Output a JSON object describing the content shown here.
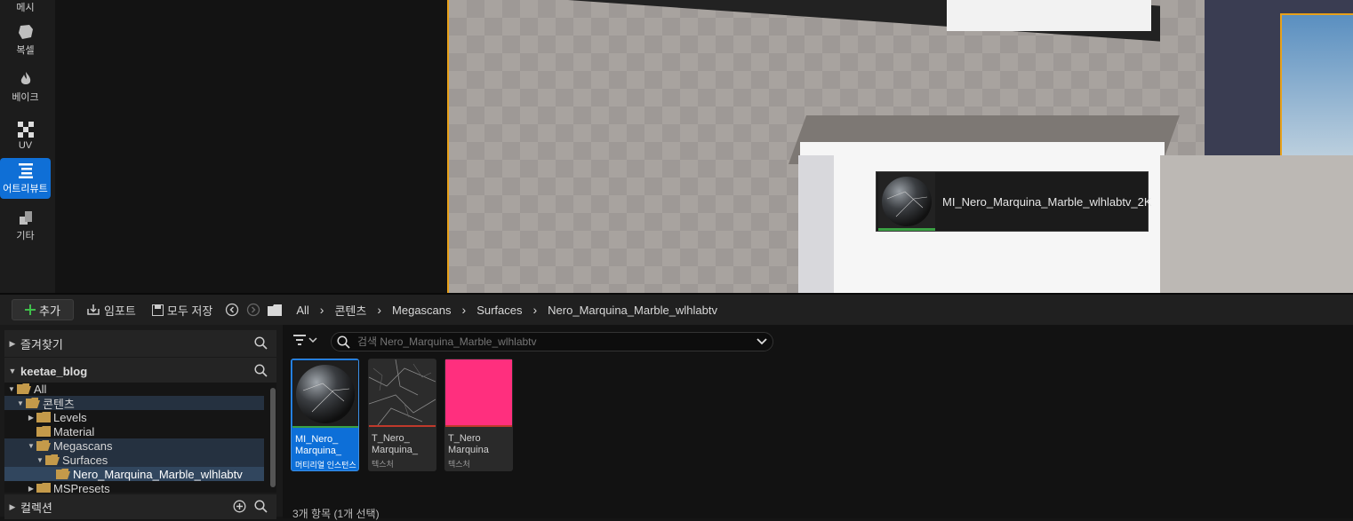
{
  "modebar": {
    "items": [
      {
        "label": "메시",
        "icon": "mesh-icon"
      },
      {
        "label": "복셀",
        "icon": "voxel-icon"
      },
      {
        "label": "베이크",
        "icon": "flame-icon"
      },
      {
        "label": "UV",
        "icon": "checker-icon"
      },
      {
        "label": "어트리뷰트",
        "icon": "list-icon",
        "active": true
      },
      {
        "label": "기타",
        "icon": "misc-icon"
      }
    ]
  },
  "viewport": {
    "drag_tooltip": "MI_Nero_Marquina_Marble_wlhlabtv_2K",
    "accent_color": "#e8a11a"
  },
  "toolbar": {
    "add_label": "추가",
    "import_label": "임포트",
    "save_all_label": "모두 저장",
    "breadcrumbs": [
      "All",
      "콘텐츠",
      "Megascans",
      "Surfaces",
      "Nero_Marquina_Marble_wlhlabtv"
    ]
  },
  "sources": {
    "favorites_label": "즐겨찾기",
    "project_label": "keetae_blog",
    "collections_label": "컬렉션",
    "tree": [
      {
        "label": "All"
      },
      {
        "label": "콘텐츠"
      },
      {
        "label": "Levels"
      },
      {
        "label": "Material"
      },
      {
        "label": "Megascans"
      },
      {
        "label": "Surfaces"
      },
      {
        "label": "Nero_Marquina_Marble_wlhlabtv"
      },
      {
        "label": "MSPresets"
      }
    ]
  },
  "assets": {
    "search_placeholder": "검색 Nero_Marquina_Marble_wlhlabtv",
    "items": [
      {
        "name_line1": "MI_Nero_",
        "name_line2": "Marquina_",
        "type": "머티리얼 인스턴스",
        "bar_color": "#3aa043",
        "selected": true
      },
      {
        "name_line1": "T_Nero_",
        "name_line2": "Marquina_",
        "type": "텍스처",
        "bar_color": "#c0392b",
        "selected": false
      },
      {
        "name_line1": "T_Nero",
        "name_line2": "Marquina",
        "type": "텍스처",
        "bar_color": "#c0392b",
        "selected": false
      }
    ],
    "status": "3개 항목 (1개 선택)"
  }
}
